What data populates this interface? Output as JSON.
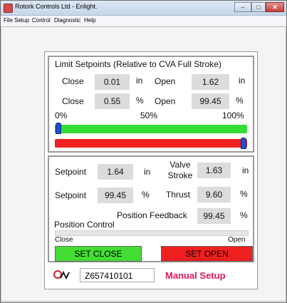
{
  "window": {
    "title": "Rotork Controls Ltd - Enlight.",
    "minimize_glyph": "–",
    "maximize_glyph": "□",
    "close_glyph": "✕"
  },
  "menu": [
    "File",
    "Setup",
    "Control",
    "Diagnostic",
    "Help"
  ],
  "limits": {
    "title": "Limit Setpoints (Relative to CVA Full Stroke)",
    "close_label": "Close",
    "open_label": "Open",
    "close_in": "0.01",
    "open_in": "1.62",
    "unit_in": "in",
    "close_pct": "0.55",
    "open_pct": "99.45",
    "unit_pct": "%",
    "scale_min": "0%",
    "scale_mid": "50%",
    "scale_max": "100%",
    "close_slider_fraction": 0.0055,
    "open_slider_fraction": 0.9945,
    "green_bar_color": "#33dd33",
    "red_bar_color": "#ee2020"
  },
  "control": {
    "setpoint_label": "Setpoint",
    "setpoint_in": "1.64",
    "unit_in": "in",
    "valve_stroke_label": "Valve\nStroke",
    "valve_stroke_line1": "Valve",
    "valve_stroke_line2": "Stroke",
    "valve_stroke_in": "1.63",
    "setpoint_pct": "99.45",
    "unit_pct": "%",
    "thrust_label": "Thrust",
    "thrust_pct": "9.60",
    "position_feedback_label": "Position Feedback",
    "position_feedback_pct": "99.45",
    "position_control_label": "Position Control",
    "close_label": "Close",
    "open_label": "Open",
    "set_close_label": "SET CLOSE",
    "set_open_label": "SET OPEN",
    "set_close_color": "#44dd33",
    "set_open_color": "#ee2020"
  },
  "footer": {
    "serial": "Z657410101",
    "mode_label": "Manual Setup",
    "mode_color": "#e0185a",
    "logo_icon": "rotork-logo-icon"
  }
}
